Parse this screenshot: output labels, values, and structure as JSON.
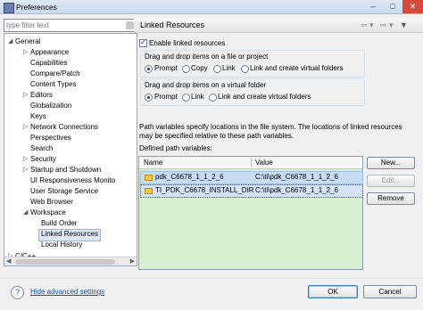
{
  "window": {
    "title": "Preferences"
  },
  "filter": {
    "placeholder": "type filter text"
  },
  "tree": {
    "nodes": [
      {
        "label": "General"
      },
      {
        "label": "Appearance"
      },
      {
        "label": "Capabilities"
      },
      {
        "label": "Compare/Patch"
      },
      {
        "label": "Content Types"
      },
      {
        "label": "Editors"
      },
      {
        "label": "Globalization"
      },
      {
        "label": "Keys"
      },
      {
        "label": "Network Connections"
      },
      {
        "label": "Perspectives"
      },
      {
        "label": "Search"
      },
      {
        "label": "Security"
      },
      {
        "label": "Startup and Shutdown"
      },
      {
        "label": "UI Responsiveness Monito"
      },
      {
        "label": "User Storage Service"
      },
      {
        "label": "Web Browser"
      },
      {
        "label": "Workspace"
      },
      {
        "label": "Build Order"
      },
      {
        "label": "Linked Resources"
      },
      {
        "label": "Local History"
      },
      {
        "label": "C/C++"
      }
    ]
  },
  "page": {
    "title": "Linked Resources",
    "enable_label": "Enable linked resources",
    "enable_checked": true,
    "files_group": {
      "title": "Drag and drop items on a file or project",
      "options": [
        "Prompt",
        "Copy",
        "Link",
        "Link and create virtual folders"
      ],
      "selected": "Prompt"
    },
    "folder_group": {
      "title": "Drag and drop items on a virtual folder",
      "options": [
        "Prompt",
        "Link",
        "Link and create virtual folders"
      ],
      "selected": "Prompt"
    },
    "desc_line1": "Path variables specify locations in the file system. The locations of linked resources",
    "desc_line2": "may be specified relative to these path variables.",
    "defined_label": "Defined path variables:",
    "table": {
      "columns": [
        "Name",
        "Value"
      ],
      "rows": [
        {
          "name": "pdk_C6678_1_1_2_6",
          "value": "C:\\ti\\pdk_C6678_1_1_2_6"
        },
        {
          "name": "TI_PDK_C6678_INSTALL_DIR",
          "value": "C:\\ti\\pdk_C6678_1_1_2_6"
        }
      ]
    },
    "buttons": {
      "new": "New...",
      "edit": "Edit...",
      "remove": "Remove"
    }
  },
  "footer": {
    "hide_advanced": "Hide advanced settings",
    "ok": "OK",
    "cancel": "Cancel"
  },
  "colors": {
    "table_bg": "#d7f0d2",
    "link": "#1a4fa3",
    "close_button": "#d74a3b"
  }
}
